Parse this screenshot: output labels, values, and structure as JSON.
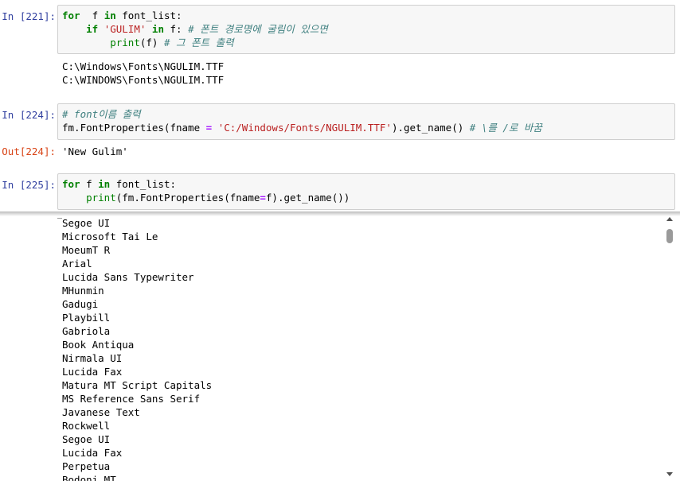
{
  "cells": [
    {
      "prompt": "In [221]:",
      "code": [
        [
          [
            "kw",
            "for"
          ],
          [
            "",
            "  f "
          ],
          [
            "kw",
            "in"
          ],
          [
            "",
            " font_list:"
          ]
        ],
        [
          [
            "",
            "    "
          ],
          [
            "kw",
            "if"
          ],
          [
            "",
            " "
          ],
          [
            "str",
            "'GULIM'"
          ],
          [
            "",
            " "
          ],
          [
            "kw",
            "in"
          ],
          [
            "",
            " f: "
          ],
          [
            "cm",
            "# 폰트 경로명에 굴림이 있으면"
          ]
        ],
        [
          [
            "",
            "        "
          ],
          [
            "bi",
            "print"
          ],
          [
            "",
            "(f) "
          ],
          [
            "cm",
            "# 그 폰트 출력"
          ]
        ]
      ],
      "output": [
        "C:\\Windows\\Fonts\\NGULIM.TTF",
        "C:\\WINDOWS\\Fonts\\NGULIM.TTF"
      ]
    },
    {
      "prompt": "In [224]:",
      "code": [
        [
          [
            "cm",
            "# font이름 출력"
          ]
        ],
        [
          [
            "",
            "fm.FontProperties(fname "
          ],
          [
            "op",
            "="
          ],
          [
            "",
            " "
          ],
          [
            "str",
            "'C:/Windows/Fonts/NGULIM.TTF'"
          ],
          [
            "",
            ").get_name() "
          ],
          [
            "cm",
            "# \\를 /로 바꿈"
          ]
        ]
      ],
      "out_prompt": "Out[224]:",
      "output": [
        "'New Gulim'"
      ]
    },
    {
      "prompt": "In [225]:",
      "code": [
        [
          [
            "kw",
            "for"
          ],
          [
            "",
            " f "
          ],
          [
            "kw",
            "in"
          ],
          [
            "",
            " font_list:"
          ]
        ],
        [
          [
            "",
            "    "
          ],
          [
            "bi",
            "print"
          ],
          [
            "",
            "(fm.FontProperties(fname"
          ],
          [
            "op",
            "="
          ],
          [
            "",
            "f).get_name())"
          ]
        ]
      ]
    }
  ],
  "font_output": [
    "Segoe UI",
    "Microsoft Tai Le",
    "MoeumT R",
    "Arial",
    "Lucida Sans Typewriter",
    "MHunmin",
    "Gadugi",
    "Playbill",
    "Gabriola",
    "Book Antiqua",
    "Nirmala UI",
    "Lucida Fax",
    "Matura MT Script Capitals",
    "MS Reference Sans Serif",
    "Javanese Text",
    "Rockwell",
    "Segoe UI",
    "Lucida Fax",
    "Perpetua",
    "Bodoni MT"
  ]
}
